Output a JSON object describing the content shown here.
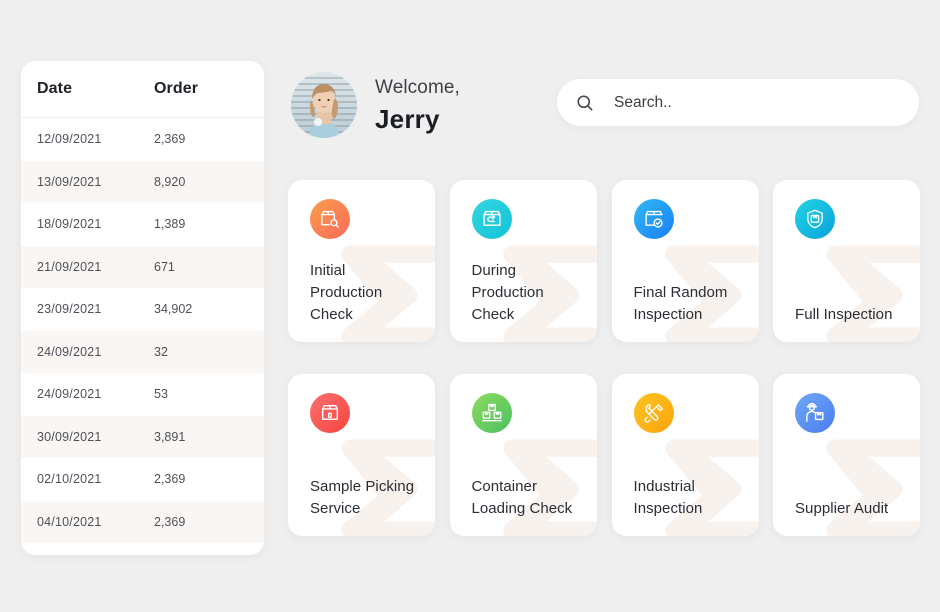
{
  "orders_table": {
    "columns": [
      "Date",
      "Order"
    ],
    "rows": [
      {
        "date": "12/09/2021",
        "order": "2,369"
      },
      {
        "date": "13/09/2021",
        "order": "8,920"
      },
      {
        "date": "18/09/2021",
        "order": "1,389"
      },
      {
        "date": "21/09/2021",
        "order": "671"
      },
      {
        "date": "23/09/2021",
        "order": "34,902"
      },
      {
        "date": "24/09/2021",
        "order": "32"
      },
      {
        "date": "24/09/2021",
        "order": "53"
      },
      {
        "date": "30/09/2021",
        "order": "3,891"
      },
      {
        "date": "02/10/2021",
        "order": "2,369"
      },
      {
        "date": "04/10/2021",
        "order": "2,369"
      }
    ]
  },
  "welcome": {
    "greeting": "Welcome,",
    "name": "Jerry",
    "avatar_icon": "user-avatar-photo"
  },
  "search": {
    "icon": "search-icon",
    "placeholder": "Search..",
    "value": ""
  },
  "services": [
    {
      "title": "Initial Production Check",
      "icon": "box-magnifier-icon",
      "color_from": "#fb9e4b",
      "color_to": "#f96a5a"
    },
    {
      "title": "During Production Check",
      "icon": "box-arrow-icon",
      "color_from": "#35d5e0",
      "color_to": "#13c2d8"
    },
    {
      "title": "Final Random Inspection",
      "icon": "box-check-icon",
      "color_from": "#2fb9f5",
      "color_to": "#1a7ef3"
    },
    {
      "title": "Full Inspection",
      "icon": "shield-box-icon",
      "color_from": "#21d3e3",
      "color_to": "#0aa3dd"
    },
    {
      "title": "Sample Picking Service",
      "icon": "box-open-icon",
      "color_from": "#fb6f6f",
      "color_to": "#f5453f"
    },
    {
      "title": "Container Loading Check",
      "icon": "stacked-boxes-icon",
      "color_from": "#8ddc5e",
      "color_to": "#4bbf63"
    },
    {
      "title": "Industrial Inspection",
      "icon": "wrench-screwdriver-icon",
      "color_from": "#ffc420",
      "color_to": "#fba30c"
    },
    {
      "title": "Supplier Audit",
      "icon": "worker-box-icon",
      "color_from": "#6fa8f7",
      "color_to": "#4b7df0"
    }
  ],
  "theme": {
    "page_background": "#efefef",
    "card_background": "#ffffff",
    "row_alt_background": "#faf6f3",
    "watermark_color": "#f8f2ee",
    "text_primary": "#20222a",
    "text_secondary": "#4d5159"
  }
}
